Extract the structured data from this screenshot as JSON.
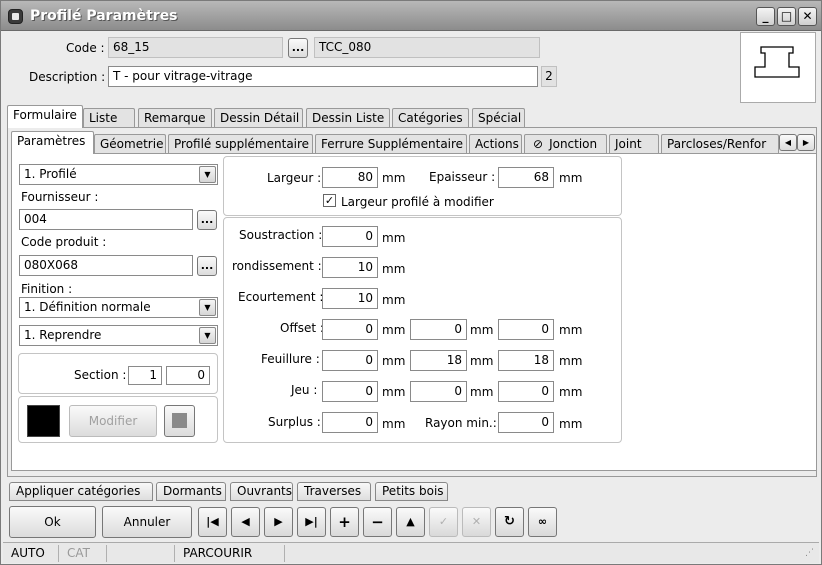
{
  "window": {
    "title": "Profilé Paramètres"
  },
  "header": {
    "code_label": "Code :",
    "code_value": "68_15",
    "code_ref": "TCC_080",
    "description_label": "Description :",
    "description_value": "T - pour vitrage-vitrage",
    "description_badge": "2",
    "browse": "..."
  },
  "main_tabs": [
    "Formulaire",
    "Liste",
    "Remarque",
    "Dessin Détail",
    "Dessin Liste",
    "Catégories",
    "Spécial"
  ],
  "sub_tabs": [
    "Paramètres",
    "Géometrie",
    "Profilé supplémentaire",
    "Ferrure Supplémentaire",
    "Actions",
    "Jonction",
    "Joint",
    "Parcloses/Renfor"
  ],
  "left": {
    "type_select": "1. Profilé",
    "fournisseur_label": "Fournisseur :",
    "fournisseur_value": "004",
    "code_produit_label": "Code produit :",
    "code_produit_value": "080X068",
    "finition_label": "Finition :",
    "finition_select": "1. Définition normale",
    "reprendre_select": "1. Reprendre",
    "section_label": "Section :",
    "section_a": "1",
    "section_b": "0",
    "modifier_label": "Modifier",
    "swatch_color": "#000000"
  },
  "dims": {
    "largeur_label": "Largeur :",
    "largeur": "80",
    "epaisseur_label": "Epaisseur :",
    "epaisseur": "68",
    "unit": "mm",
    "largeur_check_label": "Largeur profilé à modifier",
    "largeur_check": true
  },
  "params": {
    "soustraction_label": "Soustraction :",
    "soustraction": "0",
    "arrondissement_label": "rondissement :",
    "arrondissement": "10",
    "ecourtement_label": "Ecourtement :",
    "ecourtement": "10",
    "offset_label": "Offset :",
    "offset": [
      "0",
      "0",
      "0"
    ],
    "feuillure_label": "Feuillure :",
    "feuillure": [
      "0",
      "18",
      "18"
    ],
    "jeu_label": "Jeu :",
    "jeu": [
      "0",
      "0",
      "0"
    ],
    "surplus_label": "Surplus :",
    "surplus": "0",
    "rayon_label": "Rayon min.:",
    "rayon": "0"
  },
  "bottom_tabs": [
    "Appliquer catégories",
    "Dormants",
    "Ouvrants",
    "Traverses",
    "Petits bois"
  ],
  "buttons": {
    "ok": "Ok",
    "annuler": "Annuler"
  },
  "status": {
    "auto": "AUTO",
    "cat": "CAT",
    "mode": "PARCOURIR"
  }
}
